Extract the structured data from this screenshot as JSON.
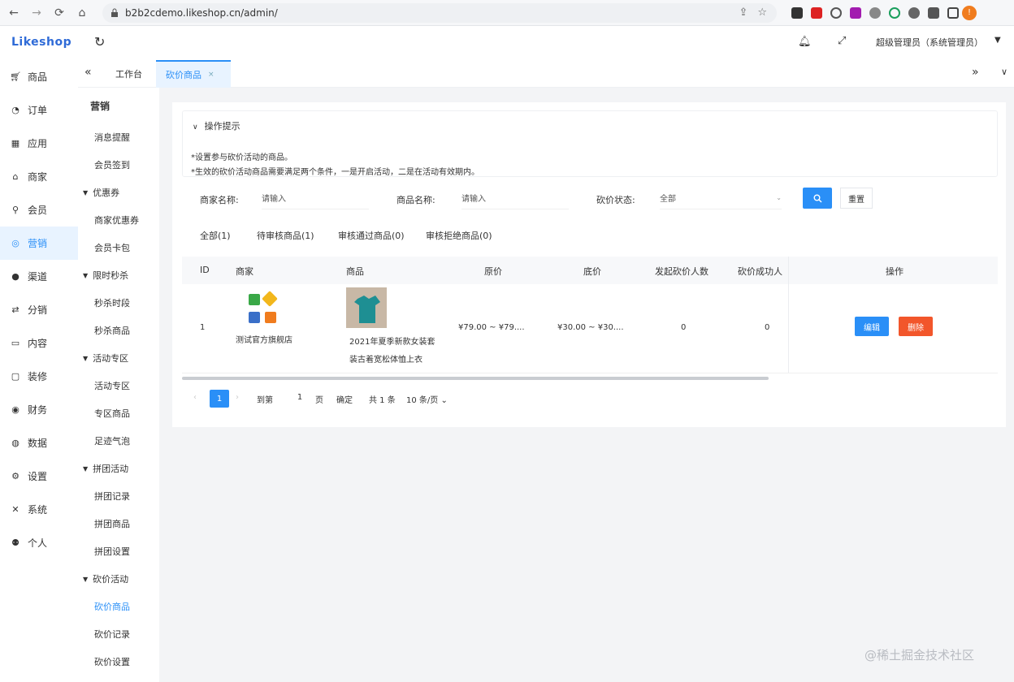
{
  "browser": {
    "url": "b2b2cdemo.likeshop.cn/admin/"
  },
  "app": {
    "logo": "Likeshop"
  },
  "main_menu": [
    {
      "label": "商品",
      "icon": "cart-icon"
    },
    {
      "label": "订单",
      "icon": "bell-icon"
    },
    {
      "label": "应用",
      "icon": "grid-icon"
    },
    {
      "label": "商家",
      "icon": "store-icon"
    },
    {
      "label": "会员",
      "icon": "user-icon"
    },
    {
      "label": "营销",
      "icon": "marketing-icon",
      "active": true
    },
    {
      "label": "渠道",
      "icon": "circle-icon"
    },
    {
      "label": "分销",
      "icon": "share-icon"
    },
    {
      "label": "内容",
      "icon": "book-icon"
    },
    {
      "label": "装修",
      "icon": "square-icon"
    },
    {
      "label": "财务",
      "icon": "money-icon"
    },
    {
      "label": "数据",
      "icon": "chart-icon"
    },
    {
      "label": "设置",
      "icon": "gear-icon"
    },
    {
      "label": "系统",
      "icon": "tool-icon"
    },
    {
      "label": "个人",
      "icon": "person-icon"
    }
  ],
  "sub_menu": {
    "title": "营销",
    "items": [
      {
        "type": "item",
        "label": "消息提醒"
      },
      {
        "type": "item",
        "label": "会员签到"
      },
      {
        "type": "group",
        "label": "优惠券"
      },
      {
        "type": "item",
        "label": "商家优惠券"
      },
      {
        "type": "item",
        "label": "会员卡包"
      },
      {
        "type": "group",
        "label": "限时秒杀"
      },
      {
        "type": "item",
        "label": "秒杀时段"
      },
      {
        "type": "item",
        "label": "秒杀商品"
      },
      {
        "type": "group",
        "label": "活动专区"
      },
      {
        "type": "item",
        "label": "活动专区"
      },
      {
        "type": "item",
        "label": "专区商品"
      },
      {
        "type": "item",
        "label": "足迹气泡"
      },
      {
        "type": "group",
        "label": "拼团活动"
      },
      {
        "type": "item",
        "label": "拼团记录"
      },
      {
        "type": "item",
        "label": "拼团商品"
      },
      {
        "type": "item",
        "label": "拼团设置"
      },
      {
        "type": "group",
        "label": "砍价活动"
      },
      {
        "type": "item",
        "label": "砍价商品",
        "active": true
      },
      {
        "type": "item",
        "label": "砍价记录"
      },
      {
        "type": "item",
        "label": "砍价设置"
      }
    ]
  },
  "header": {
    "user": "超级管理员（系统管理员）"
  },
  "tabs": [
    {
      "label": "工作台"
    },
    {
      "label": "砍价商品",
      "active": true,
      "close": "×"
    }
  ],
  "tips": {
    "title": "操作提示",
    "lines": [
      "*设置参与砍价活动的商品。",
      "*生效的砍价活动商品需要满足两个条件，一是开启活动，二是在活动有效期内。"
    ]
  },
  "filters": {
    "shop_label": "商家名称:",
    "shop_placeholder": "请输入",
    "goods_label": "商品名称:",
    "goods_placeholder": "请输入",
    "status_label": "砍价状态:",
    "status_value": "全部",
    "reset_label": "重置"
  },
  "status_tabs": [
    "全部(1)",
    "待审核商品(1)",
    "审核通过商品(0)",
    "审核拒绝商品(0)"
  ],
  "table": {
    "columns": [
      "ID",
      "商家",
      "商品",
      "原价",
      "底价",
      "发起砍价人数",
      "砍价成功人",
      "操作"
    ],
    "rows": [
      {
        "id": "1",
        "shop": "测试官方旗舰店",
        "goods": "2021年夏季新款女装套",
        "goods_line2": "装古着宽松体恤上衣",
        "price": "¥79.00 ~ ¥79....",
        "floor_price": "¥30.00 ~ ¥30....",
        "initiated": "0",
        "success": "0",
        "edit_label": "编辑",
        "delete_label": "删除"
      }
    ]
  },
  "pagination": {
    "current": "1",
    "goto_label": "到第",
    "goto_value": "1",
    "page_unit": "页",
    "confirm_label": "确定",
    "total": "共 1 条",
    "page_size": "10 条/页"
  },
  "watermark": "@稀土掘金技术社区",
  "colors": {
    "primary": "#2a8ff7",
    "danger": "#f2562b",
    "active_bg": "#e8f3ff"
  }
}
